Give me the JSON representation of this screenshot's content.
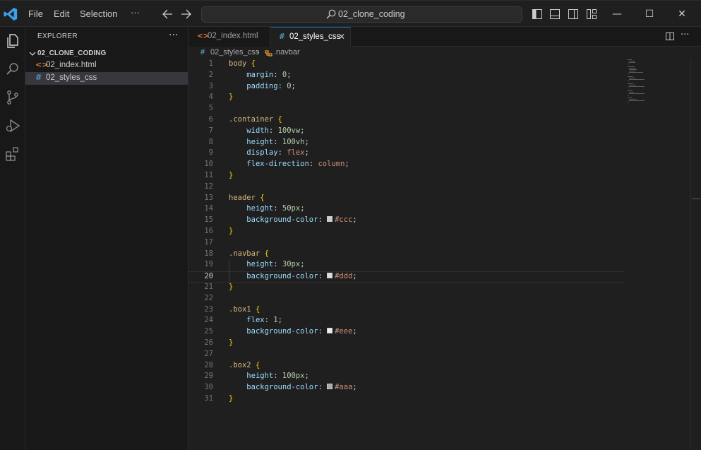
{
  "menu": {
    "file": "File",
    "edit": "Edit",
    "selection": "Selection",
    "more": "···"
  },
  "search": {
    "text": "02_clone_coding"
  },
  "window_controls": {
    "minimize": "—",
    "maximize": "☐",
    "close": "✕"
  },
  "sidebar": {
    "title": "EXPLORER",
    "more": "···",
    "folder": "02_CLONE_CODING",
    "files": [
      {
        "icon": "<>",
        "name": "02_index.html",
        "color": "#e37933"
      },
      {
        "icon": "#",
        "name": "02_styles_css",
        "color": "#519aba"
      }
    ]
  },
  "tabs": [
    {
      "icon": "<>",
      "label": "02_index.html",
      "color": "#e37933"
    },
    {
      "icon": "#",
      "label": "02_styles_css",
      "color": "#519aba",
      "close": "✕"
    }
  ],
  "tab_actions": {
    "split": "◫",
    "more": "···"
  },
  "breadcrumb": {
    "file": "02_styles_css",
    "separator": "›",
    "symbol": ".navbar"
  },
  "editor": {
    "current_line": 20,
    "lines": [
      "1",
      "2",
      "3",
      "4",
      "5",
      "6",
      "7",
      "8",
      "9",
      "10",
      "11",
      "12",
      "13",
      "14",
      "15",
      "16",
      "17",
      "18",
      "19",
      "20",
      "21",
      "22",
      "23",
      "24",
      "25",
      "26",
      "27",
      "28",
      "29",
      "30",
      "31"
    ],
    "code": {
      "body_sel": "body",
      "ob": "{",
      "cb": "}",
      "margin": "margin",
      "padding": "padding",
      "zero": "0",
      "container_sel": ".container",
      "width": "width",
      "v100vw": "100vw",
      "height": "height",
      "v100vh": "100vh",
      "display": "display",
      "flex_val": "flex",
      "flex_direction": "flex-direction",
      "column": "column",
      "header_sel": "header",
      "v50px": "50px",
      "background_color": "background-color",
      "ccc": "#ccc",
      "navbar_sel": ".navbar",
      "v30px": "30px",
      "ddd": "#ddd",
      "box1_sel": ".box1",
      "flex": "flex",
      "one": "1",
      "eee": "#eee",
      "box2_sel": ".box2",
      "v100px": "100px",
      "aaa": "#aaa"
    },
    "swatches": {
      "ccc": "#cccccc",
      "ddd": "#dddddd",
      "eee": "#eeeeee",
      "aaa": "#aaaaaa"
    }
  },
  "colors": {
    "accent": "#0078d4",
    "selector": "#d7ba7d",
    "property": "#9cdcfe",
    "number": "#b5cea8",
    "string": "#ce9178"
  }
}
